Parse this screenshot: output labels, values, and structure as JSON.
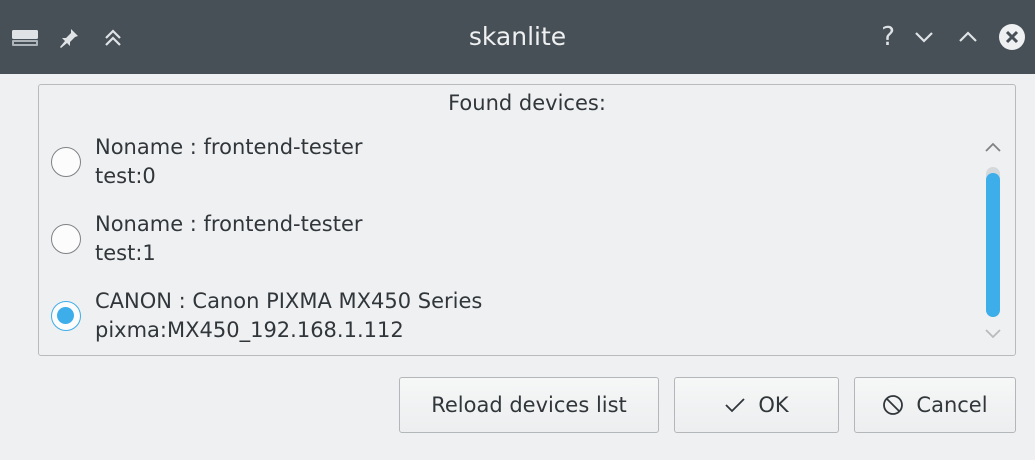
{
  "window": {
    "title": "skanlite",
    "left_icons": [
      "scanner-app-icon",
      "pin-icon",
      "keep-above-icon"
    ],
    "right_controls": {
      "help_label": "?",
      "minimize_icon": "chevron-down-icon",
      "maximize_icon": "chevron-up-icon",
      "close_icon": "close-circle-icon"
    }
  },
  "devices": {
    "frame_title": "Found devices:",
    "items": [
      {
        "line1": "Noname : frontend-tester",
        "line2": "test:0",
        "checked": false
      },
      {
        "line1": "Noname : frontend-tester",
        "line2": "test:1",
        "checked": false
      },
      {
        "line1": "CANON : Canon PIXMA MX450 Series",
        "line2": "pixma:MX450_192.168.1.112",
        "checked": true
      }
    ]
  },
  "buttons": {
    "reload_label": "Reload devices list",
    "ok_label": "OK",
    "cancel_label": "Cancel"
  },
  "colors": {
    "titlebar": "#475057",
    "accent": "#3daee9",
    "window_bg": "#eff0f1",
    "text": "#31363b"
  }
}
